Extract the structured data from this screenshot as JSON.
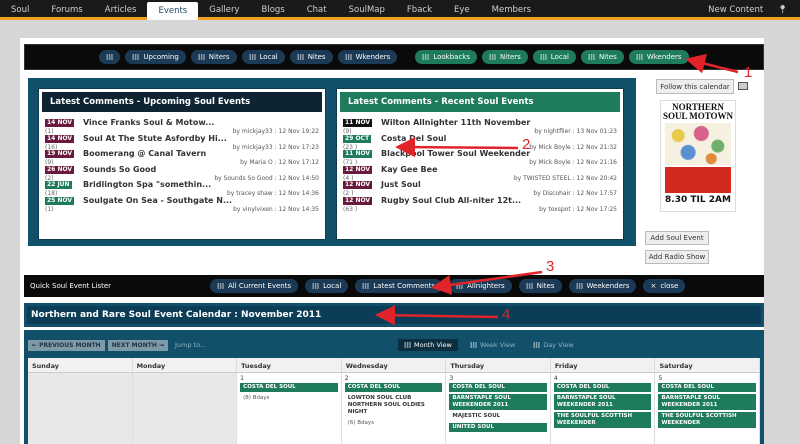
{
  "nav": {
    "items": [
      "Soul",
      "Forums",
      "Articles",
      "Events",
      "Gallery",
      "Blogs",
      "Chat",
      "SoulMap",
      "Fback",
      "Eye",
      "Members"
    ],
    "active": "Events",
    "right": "New Content"
  },
  "filters": {
    "upcoming": [
      "Upcoming",
      "Niters",
      "Local",
      "Nites",
      "Wkenders"
    ],
    "past": [
      "Lookbacks",
      "Niters",
      "Local",
      "Nites",
      "Wkenders"
    ]
  },
  "upcoming_panel": {
    "title": "Latest Comments - Upcoming Soul Events",
    "rows": [
      {
        "date": "14 NOV",
        "title": "Vince Franks Soul & Motow...",
        "count": "(1)",
        "by": "by mickjay33 :",
        "time": "12 Nov 19:22",
        "color": "maroon"
      },
      {
        "date": "14 NOV",
        "title": "Soul At The Stute Asfordby Hi...",
        "count": "(16)",
        "by": "by mickjay33 :",
        "time": "12 Nov 17:23",
        "color": "maroon"
      },
      {
        "date": "19 NOV",
        "title": "Boomerang @ Canal Tavern",
        "count": "(9)",
        "by": "by Maria O :",
        "time": "12 Nov 17:12",
        "color": "maroon"
      },
      {
        "date": "26 NOV",
        "title": "Sounds So Good",
        "count": "(2)",
        "by": "by Sounds So Good :",
        "time": "12 Nov 14:50",
        "color": "maroon"
      },
      {
        "date": "22 JUN",
        "title": "Bridlington Spa \"somethin...",
        "count": "(18)",
        "by": "by tracey shaw :",
        "time": "12 Nov 14:36",
        "color": "dgreen"
      },
      {
        "date": "25 NOV",
        "title": "Soulgate On Sea - Southgate N...",
        "count": "(1)",
        "by": "by vinylvixen :",
        "time": "12 Nov 14:35",
        "color": "dgreen"
      }
    ]
  },
  "recent_panel": {
    "title": "Latest Comments - Recent Soul Events",
    "rows": [
      {
        "date": "11 NOV",
        "title": "Wilton Allnighter 11th November",
        "count": "(9)",
        "by": "by nightflier :",
        "time": "13 Nov 01:23",
        "color": "black"
      },
      {
        "date": "29 OCT",
        "title": "Costa Del Soul",
        "count": "(23 )",
        "by": "by Mick Boyle :",
        "time": "12 Nov 21:32",
        "color": "dgreen"
      },
      {
        "date": "11 NOV",
        "title": "Blackpool Tower Soul Weekender",
        "count": "(71 )",
        "by": "by Mick Boyle :",
        "time": "12 Nov 21:16",
        "color": "dgreen"
      },
      {
        "date": "12 NOV",
        "title": "Kay Gee Bee",
        "count": "(4 )",
        "by": "by TWISTED STEEL :",
        "time": "12 Nov 20:42",
        "color": "maroon"
      },
      {
        "date": "12 NOV",
        "title": "Just Soul",
        "count": "(2 )",
        "by": "by Discohair :",
        "time": "12 Nov 17:57",
        "color": "maroon"
      },
      {
        "date": "12 NOV",
        "title": "Rugby Soul Club All-niter 12t...",
        "count": "(63 )",
        "by": "by toxspot :",
        "time": "12 Nov 17:25",
        "color": "maroon"
      }
    ]
  },
  "sidebar": {
    "follow": "Follow this calendar",
    "flyer_top": "NORTHERN SOUL MOTOWN",
    "flyer_bottom": "8.30 TIL 2AM",
    "add_event": "Add Soul Event",
    "add_radio": "Add Radio Show"
  },
  "quick": {
    "label": "Quick Soul Event Lister",
    "items": [
      "All Current Events",
      "Local",
      "Latest Comments",
      "Allnighters",
      "Nites",
      "Weekenders",
      "close"
    ]
  },
  "calendar": {
    "title": "Northern and Rare Soul Event Calendar : November 2011",
    "prev": "← PREVIOUS MONTH",
    "next": "NEXT MONTH →",
    "jump": "Jump to...",
    "views": [
      "Month View",
      "Week View",
      "Day View"
    ],
    "days": [
      "Sunday",
      "Monday",
      "Tuesday",
      "Wednesday",
      "Thursday",
      "Friday",
      "Saturday"
    ],
    "cells": [
      {
        "num": "",
        "events": []
      },
      {
        "num": "",
        "events": []
      },
      {
        "num": "1",
        "events": [
          {
            "t": "COSTA DEL SOUL",
            "k": "ev"
          },
          {
            "t": "(8) Bdays",
            "k": "small"
          }
        ]
      },
      {
        "num": "2",
        "events": [
          {
            "t": "COSTA DEL SOUL",
            "k": "ev"
          },
          {
            "t": "LOWTON SOUL CLUB NORTHERN SOUL OLDIES NIGHT",
            "k": "txt"
          },
          {
            "t": "(6) Bdays",
            "k": "small"
          }
        ]
      },
      {
        "num": "3",
        "events": [
          {
            "t": "COSTA DEL SOUL",
            "k": "ev"
          },
          {
            "t": "BARNSTAPLE SOUL WEEKENDER 2011",
            "k": "ev"
          },
          {
            "t": "MAJESTIC SOUL",
            "k": "txt"
          },
          {
            "t": "UNITED SOUL",
            "k": "ev"
          }
        ]
      },
      {
        "num": "4",
        "events": [
          {
            "t": "COSTA DEL SOUL",
            "k": "ev"
          },
          {
            "t": "BARNSTAPLE SOUL WEEKENDER 2011",
            "k": "ev"
          },
          {
            "t": "THE SOULFUL SCOTTISH WEEKENDER",
            "k": "ev"
          }
        ]
      },
      {
        "num": "5",
        "events": [
          {
            "t": "COSTA DEL SOUL",
            "k": "ev"
          },
          {
            "t": "BARNSTAPLE SOUL WEEKENDER 2011",
            "k": "ev"
          },
          {
            "t": "THE SOULFUL SCOTTISH WEEKENDER",
            "k": "ev"
          }
        ]
      }
    ]
  },
  "annotations": [
    "1",
    "2",
    "3",
    "4"
  ],
  "colors": {
    "accent": "#f0a020",
    "navy": "#1b3a55",
    "green": "#1e7b5c",
    "teal": "#114f6b",
    "maroon": "#6a1a3e",
    "arrow": "#e0242a"
  }
}
